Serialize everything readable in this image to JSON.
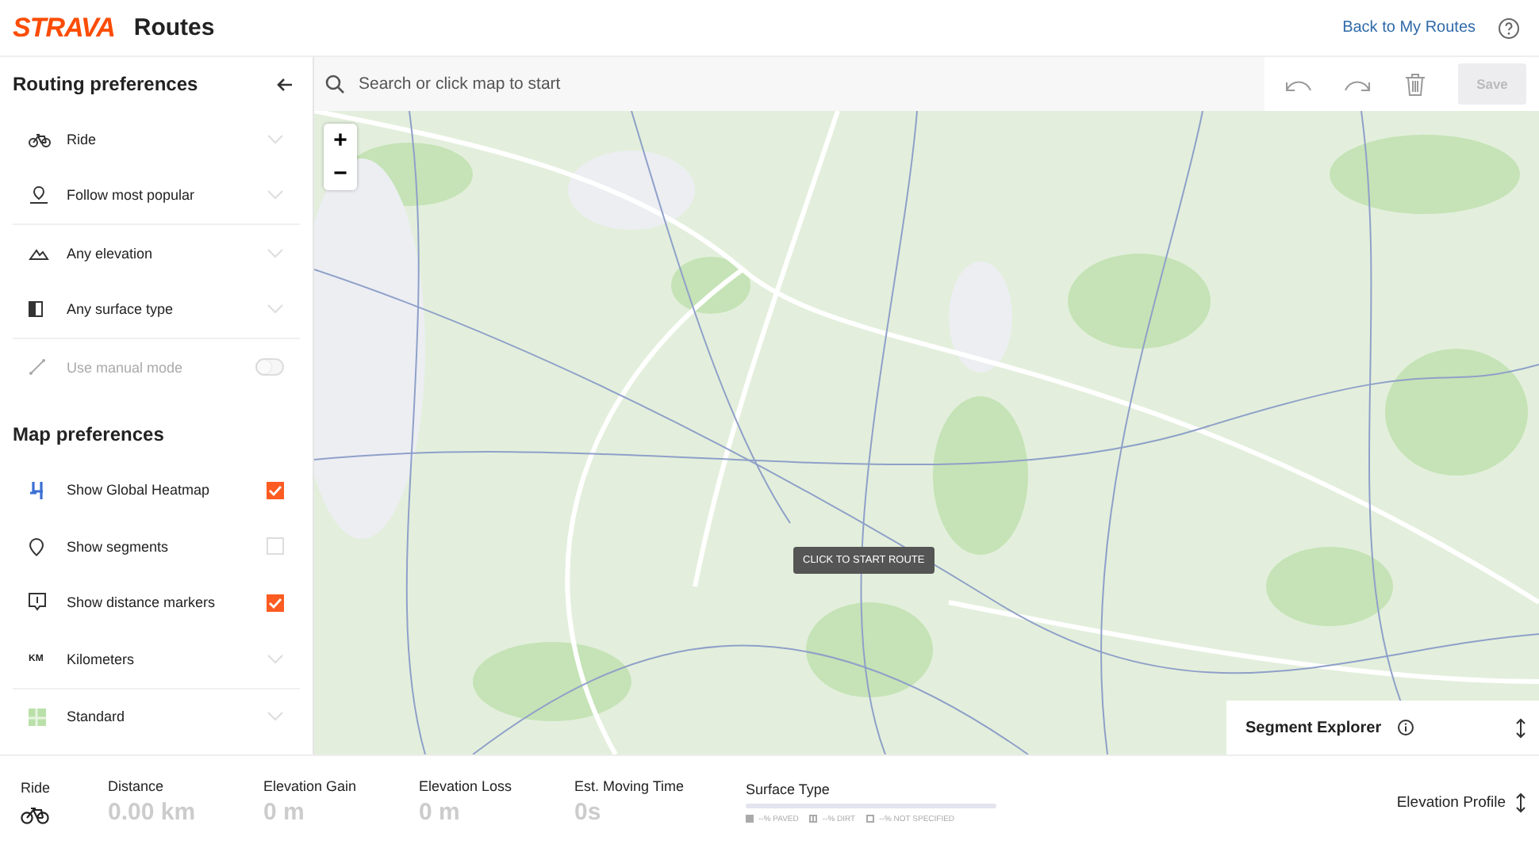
{
  "header": {
    "logo": "STRAVA",
    "title": "Routes",
    "back_link": "Back to My Routes"
  },
  "sidebar": {
    "routing_title": "Routing preferences",
    "routing_options": [
      {
        "label": "Ride",
        "kind": "dropdown"
      },
      {
        "label": "Follow most popular",
        "kind": "dropdown"
      },
      {
        "label": "Any elevation",
        "kind": "dropdown"
      },
      {
        "label": "Any surface type",
        "kind": "dropdown"
      },
      {
        "label": "Use manual mode",
        "kind": "toggle",
        "on": false,
        "disabled": true
      }
    ],
    "map_title": "Map preferences",
    "map_options": [
      {
        "label": "Show Global Heatmap",
        "kind": "checkbox",
        "checked": true
      },
      {
        "label": "Show segments",
        "kind": "checkbox",
        "checked": false
      },
      {
        "label": "Show distance markers",
        "kind": "checkbox",
        "checked": true
      },
      {
        "label": "Kilometers",
        "kind": "dropdown",
        "icon_text": "KM"
      },
      {
        "label": "Standard",
        "kind": "dropdown"
      }
    ]
  },
  "toolbar": {
    "search_placeholder": "Search or click map to start",
    "save": {
      "label": "Save",
      "disabled": true
    }
  },
  "map": {
    "zoom_in": "+",
    "zoom_out": "−",
    "tooltip": "CLICK TO START ROUTE",
    "segment_explorer": "Segment Explorer"
  },
  "stats_bar": {
    "sport": "Ride",
    "stats": [
      {
        "label": "Distance",
        "value": "0.00 km"
      },
      {
        "label": "Elevation Gain",
        "value": "0 m"
      },
      {
        "label": "Elevation Loss",
        "value": "0 m"
      },
      {
        "label": "Est. Moving Time",
        "value": "0s"
      }
    ],
    "surface": {
      "label": "Surface Type",
      "legend": [
        "--% PAVED",
        "--% DIRT",
        "--% NOT SPECIFIED"
      ]
    },
    "elevation_profile": "Elevation Profile"
  }
}
